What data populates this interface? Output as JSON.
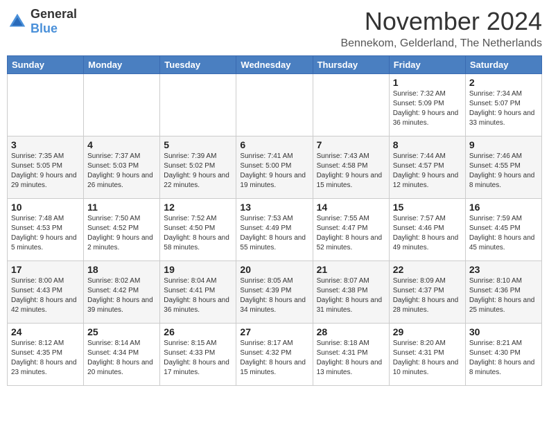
{
  "logo": {
    "general": "General",
    "blue": "Blue"
  },
  "title": "November 2024",
  "location": "Bennekom, Gelderland, The Netherlands",
  "headers": [
    "Sunday",
    "Monday",
    "Tuesday",
    "Wednesday",
    "Thursday",
    "Friday",
    "Saturday"
  ],
  "weeks": [
    [
      {
        "day": "",
        "info": ""
      },
      {
        "day": "",
        "info": ""
      },
      {
        "day": "",
        "info": ""
      },
      {
        "day": "",
        "info": ""
      },
      {
        "day": "",
        "info": ""
      },
      {
        "day": "1",
        "info": "Sunrise: 7:32 AM\nSunset: 5:09 PM\nDaylight: 9 hours and 36 minutes."
      },
      {
        "day": "2",
        "info": "Sunrise: 7:34 AM\nSunset: 5:07 PM\nDaylight: 9 hours and 33 minutes."
      }
    ],
    [
      {
        "day": "3",
        "info": "Sunrise: 7:35 AM\nSunset: 5:05 PM\nDaylight: 9 hours and 29 minutes."
      },
      {
        "day": "4",
        "info": "Sunrise: 7:37 AM\nSunset: 5:03 PM\nDaylight: 9 hours and 26 minutes."
      },
      {
        "day": "5",
        "info": "Sunrise: 7:39 AM\nSunset: 5:02 PM\nDaylight: 9 hours and 22 minutes."
      },
      {
        "day": "6",
        "info": "Sunrise: 7:41 AM\nSunset: 5:00 PM\nDaylight: 9 hours and 19 minutes."
      },
      {
        "day": "7",
        "info": "Sunrise: 7:43 AM\nSunset: 4:58 PM\nDaylight: 9 hours and 15 minutes."
      },
      {
        "day": "8",
        "info": "Sunrise: 7:44 AM\nSunset: 4:57 PM\nDaylight: 9 hours and 12 minutes."
      },
      {
        "day": "9",
        "info": "Sunrise: 7:46 AM\nSunset: 4:55 PM\nDaylight: 9 hours and 8 minutes."
      }
    ],
    [
      {
        "day": "10",
        "info": "Sunrise: 7:48 AM\nSunset: 4:53 PM\nDaylight: 9 hours and 5 minutes."
      },
      {
        "day": "11",
        "info": "Sunrise: 7:50 AM\nSunset: 4:52 PM\nDaylight: 9 hours and 2 minutes."
      },
      {
        "day": "12",
        "info": "Sunrise: 7:52 AM\nSunset: 4:50 PM\nDaylight: 8 hours and 58 minutes."
      },
      {
        "day": "13",
        "info": "Sunrise: 7:53 AM\nSunset: 4:49 PM\nDaylight: 8 hours and 55 minutes."
      },
      {
        "day": "14",
        "info": "Sunrise: 7:55 AM\nSunset: 4:47 PM\nDaylight: 8 hours and 52 minutes."
      },
      {
        "day": "15",
        "info": "Sunrise: 7:57 AM\nSunset: 4:46 PM\nDaylight: 8 hours and 49 minutes."
      },
      {
        "day": "16",
        "info": "Sunrise: 7:59 AM\nSunset: 4:45 PM\nDaylight: 8 hours and 45 minutes."
      }
    ],
    [
      {
        "day": "17",
        "info": "Sunrise: 8:00 AM\nSunset: 4:43 PM\nDaylight: 8 hours and 42 minutes."
      },
      {
        "day": "18",
        "info": "Sunrise: 8:02 AM\nSunset: 4:42 PM\nDaylight: 8 hours and 39 minutes."
      },
      {
        "day": "19",
        "info": "Sunrise: 8:04 AM\nSunset: 4:41 PM\nDaylight: 8 hours and 36 minutes."
      },
      {
        "day": "20",
        "info": "Sunrise: 8:05 AM\nSunset: 4:39 PM\nDaylight: 8 hours and 34 minutes."
      },
      {
        "day": "21",
        "info": "Sunrise: 8:07 AM\nSunset: 4:38 PM\nDaylight: 8 hours and 31 minutes."
      },
      {
        "day": "22",
        "info": "Sunrise: 8:09 AM\nSunset: 4:37 PM\nDaylight: 8 hours and 28 minutes."
      },
      {
        "day": "23",
        "info": "Sunrise: 8:10 AM\nSunset: 4:36 PM\nDaylight: 8 hours and 25 minutes."
      }
    ],
    [
      {
        "day": "24",
        "info": "Sunrise: 8:12 AM\nSunset: 4:35 PM\nDaylight: 8 hours and 23 minutes."
      },
      {
        "day": "25",
        "info": "Sunrise: 8:14 AM\nSunset: 4:34 PM\nDaylight: 8 hours and 20 minutes."
      },
      {
        "day": "26",
        "info": "Sunrise: 8:15 AM\nSunset: 4:33 PM\nDaylight: 8 hours and 17 minutes."
      },
      {
        "day": "27",
        "info": "Sunrise: 8:17 AM\nSunset: 4:32 PM\nDaylight: 8 hours and 15 minutes."
      },
      {
        "day": "28",
        "info": "Sunrise: 8:18 AM\nSunset: 4:31 PM\nDaylight: 8 hours and 13 minutes."
      },
      {
        "day": "29",
        "info": "Sunrise: 8:20 AM\nSunset: 4:31 PM\nDaylight: 8 hours and 10 minutes."
      },
      {
        "day": "30",
        "info": "Sunrise: 8:21 AM\nSunset: 4:30 PM\nDaylight: 8 hours and 8 minutes."
      }
    ]
  ],
  "colors": {
    "header_bg": "#4a7fc1",
    "header_text": "#ffffff",
    "border": "#cccccc",
    "row_even": "#f5f5f5",
    "row_odd": "#ffffff"
  }
}
